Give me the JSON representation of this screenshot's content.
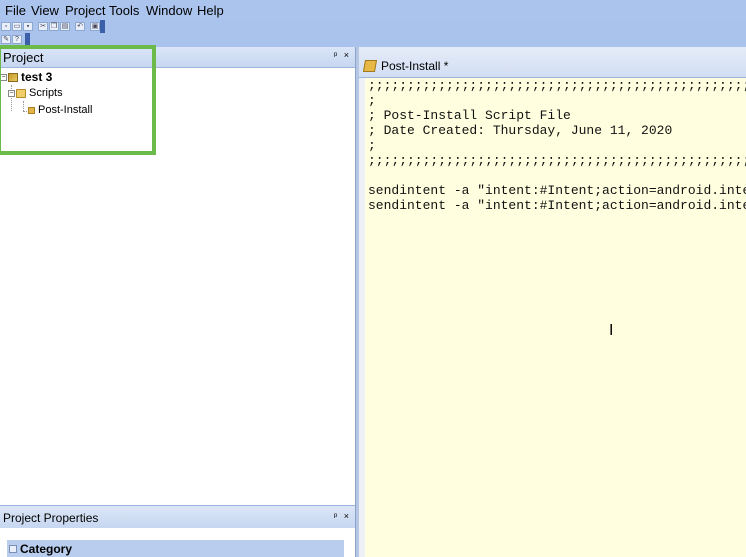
{
  "menu": [
    "File",
    "View",
    "Project",
    "Tools",
    "Window",
    "Help"
  ],
  "toolbar": {
    "row1_icons": [
      "new-project-icon",
      "open-icon",
      "save-icon",
      "sep",
      "cut-icon",
      "copy-icon",
      "paste-icon",
      "sep",
      "undo-icon",
      "sep",
      "build-icon"
    ],
    "row2_icons": [
      "properties-icon",
      "help-icon"
    ]
  },
  "project_panel": {
    "title": "Project",
    "controls": "ᵖ ×",
    "tree": {
      "root": "test 3",
      "folder": "Scripts",
      "file": "Post-Install"
    }
  },
  "properties_panel": {
    "title": "Project Properties",
    "controls": "ᵖ ×",
    "category": "Category"
  },
  "editor": {
    "tab_label": "Post-Install *",
    "lines": [
      ";;;;;;;;;;;;;;;;;;;;;;;;;;;;;;;;;;;;;;;;;;;;;;;;;;;;;;;;;;;;",
      ";",
      "; Post-Install Script File",
      "; Date Created: Thursday, June 11, 2020",
      ";",
      ";;;;;;;;;;;;;;;;;;;;;;;;;;;;;;;;;;;;;;;;;;;;;;;;;;;;;;;;;;;;",
      "",
      "sendintent -a \"intent:#Intent;action=android.intent.action.MAIN",
      "sendintent -a \"intent:#Intent;action=android.intent.action.MAIN"
    ],
    "cursor_glyph": "I"
  },
  "colors": {
    "highlight_border": "#6cbb4a",
    "editor_bg": "#ffffdf",
    "chrome_bg": "#a9c3ec"
  }
}
